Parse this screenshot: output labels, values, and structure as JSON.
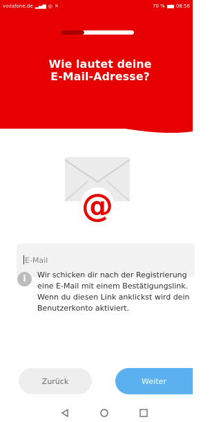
{
  "status_bar": {
    "carrier": "vodafone.de",
    "battery": "70 %",
    "time": "08:56"
  },
  "progress": {
    "fraction": 0.32
  },
  "page": {
    "title_line1": "Wie lautet deine",
    "title_line2": "E-Mail-Adresse?"
  },
  "illustration": {
    "icon": "email-envelope-at-icon"
  },
  "email": {
    "placeholder": "E-Mail",
    "value": ""
  },
  "info": {
    "lines": [
      "Wir schicken dir nach der Registrierung",
      "eine E-Mail mit einem Bestätigungslink.",
      "Wenn du diesen Link anklickst wird dein",
      "Benutzerkonto aktiviert."
    ]
  },
  "buttons": {
    "back": "Zurück",
    "next": "Weiter"
  },
  "colors": {
    "brand_red": "#e60000",
    "accent_blue": "#5bb0f0"
  },
  "nav": {
    "icons": [
      "back-triangle-icon",
      "home-circle-icon",
      "recents-square-icon"
    ]
  }
}
